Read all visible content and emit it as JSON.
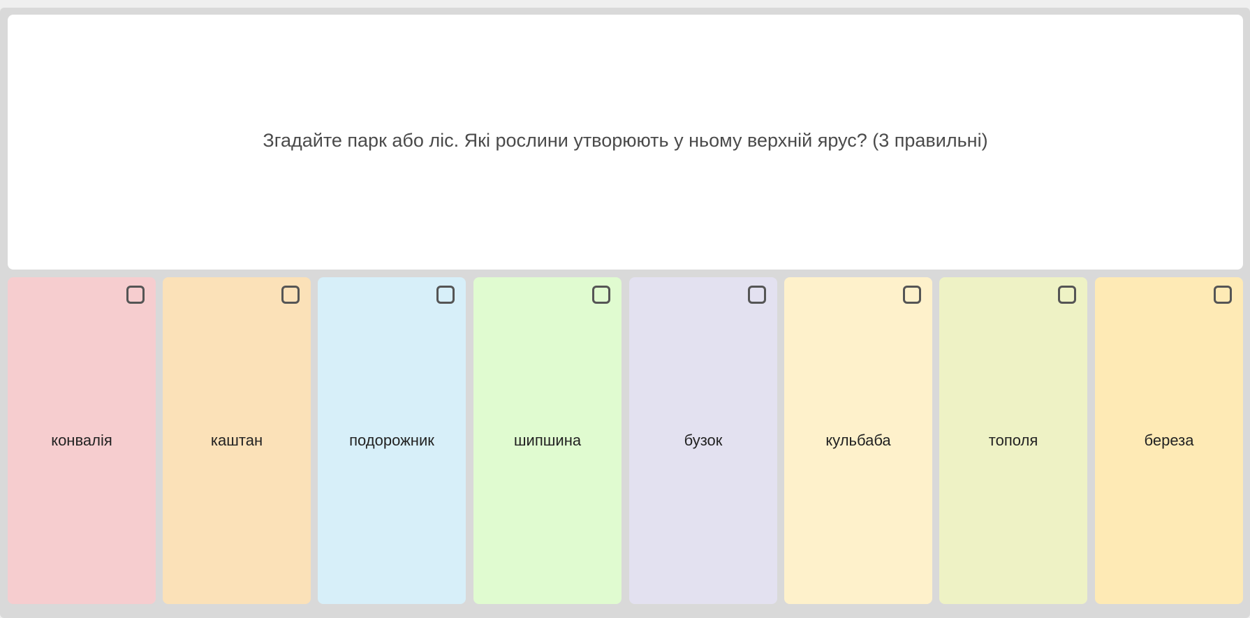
{
  "question": {
    "text": "Згадайте парк або ліс. Які рослини утворюють у ньому верхній ярус? (3 правильні)"
  },
  "options": [
    {
      "label": "конвалія",
      "color": "#f6cdcf",
      "checked": false
    },
    {
      "label": "каштан",
      "color": "#fbe1b8",
      "checked": false
    },
    {
      "label": "подорожник",
      "color": "#d7eff9",
      "checked": false
    },
    {
      "label": "шипшина",
      "color": "#e0fbd0",
      "checked": false
    },
    {
      "label": "бузок",
      "color": "#e3e1f0",
      "checked": false
    },
    {
      "label": "кульбаба",
      "color": "#fef1cb",
      "checked": false
    },
    {
      "label": "тополя",
      "color": "#eef2c5",
      "checked": false
    },
    {
      "label": "береза",
      "color": "#feeab5",
      "checked": false
    }
  ],
  "colors": {
    "frame": "#d9d9d9",
    "panel": "#ffffff",
    "question_text": "#4a4a4a",
    "checkbox_border": "#555555"
  },
  "icons": {
    "checkbox": "checkbox-icon"
  }
}
